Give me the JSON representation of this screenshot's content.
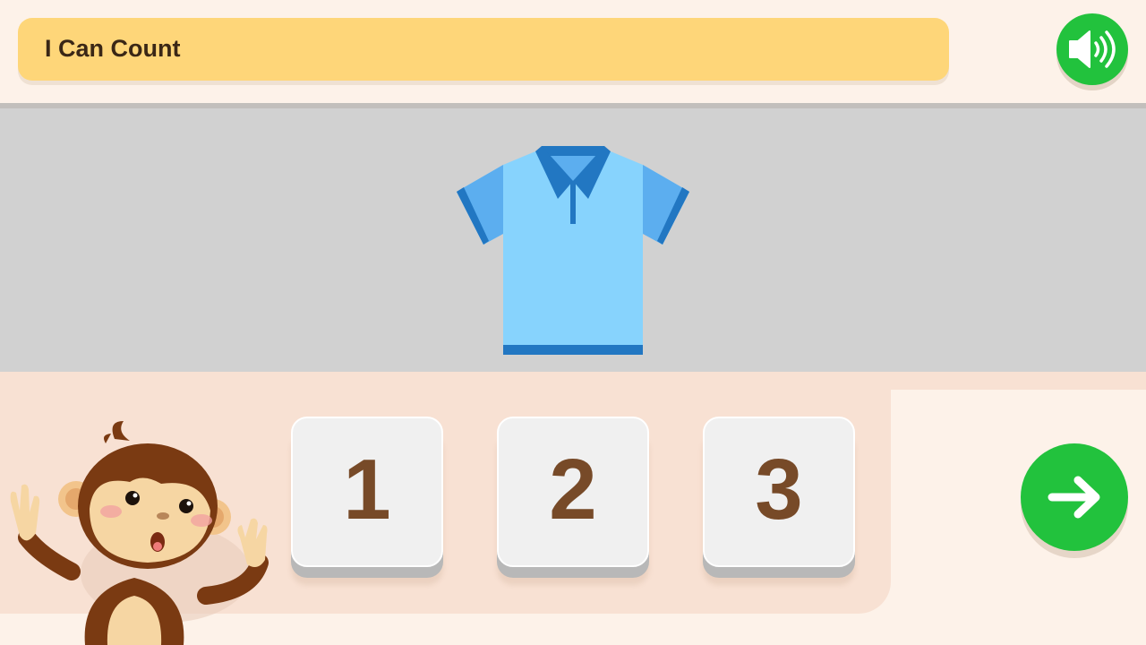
{
  "header": {
    "title": "I Can Count"
  },
  "audio": {
    "icon": "speaker-icon"
  },
  "question": {
    "image": "polo-shirt",
    "count_shown": 1
  },
  "answers": [
    {
      "label": "1"
    },
    {
      "label": "2"
    },
    {
      "label": "3"
    }
  ],
  "navigation": {
    "icon": "arrow-right-icon"
  },
  "colors": {
    "title_bar": "#fed679",
    "accent_green": "#22c23d",
    "number_brown": "#774a28",
    "shirt_body": "#87d3fd",
    "shirt_trim": "#2277c2"
  }
}
